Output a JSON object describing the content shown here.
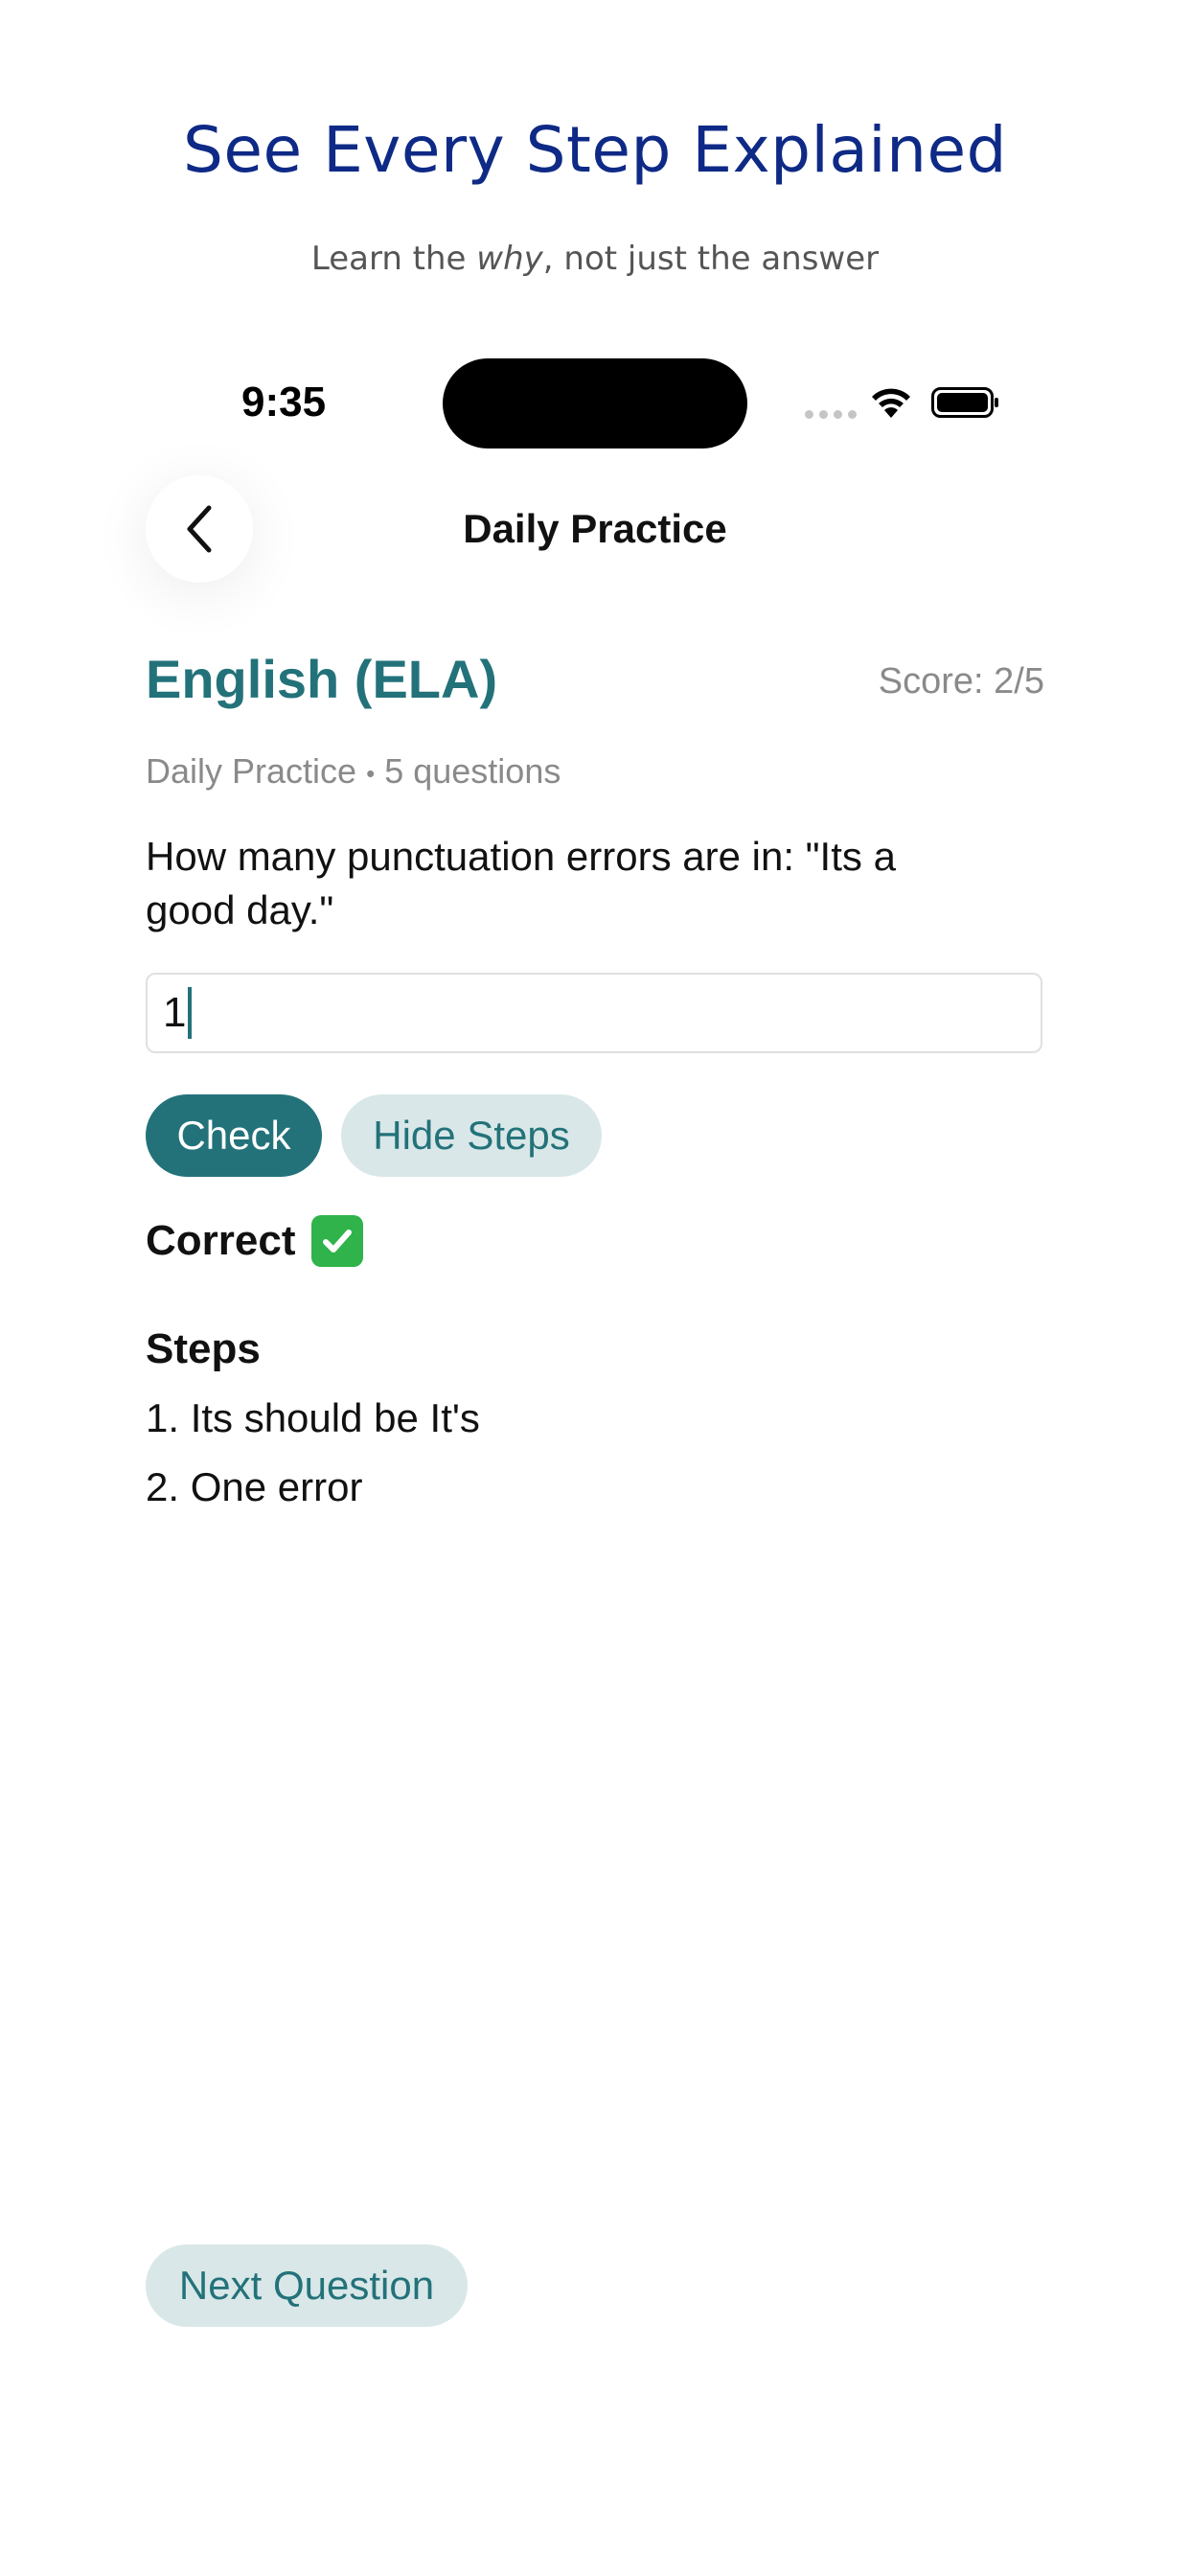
{
  "promo": {
    "title": "See Every Step Explained",
    "subtitle_pre": "Learn the ",
    "subtitle_em": "why",
    "subtitle_post": ", not just the answer"
  },
  "status_bar": {
    "time": "9:35",
    "icons": [
      "cellular-signal-icon",
      "wifi-icon",
      "battery-icon"
    ]
  },
  "nav": {
    "back_icon": "chevron-left-icon",
    "title": "Daily Practice"
  },
  "practice": {
    "subject": "English (ELA)",
    "score": "Score: 2/5",
    "meta_mode": "Daily Practice",
    "meta_separator": "•",
    "meta_count": "5 questions",
    "question": "How many punctuation errors are in: \"Its a good day.\"",
    "answer_value": "1",
    "check_label": "Check",
    "toggle_steps_label": "Hide Steps",
    "result_label": "Correct",
    "result_icon": "check-mark-button-icon",
    "steps_heading": "Steps",
    "steps": [
      "1. Its should be It's",
      "2. One error"
    ],
    "next_label": "Next Question"
  },
  "colors": {
    "accent": "#23727a",
    "accent_soft": "#d9e7e8",
    "promo_title": "#0e2a86",
    "success": "#2fb34a"
  }
}
